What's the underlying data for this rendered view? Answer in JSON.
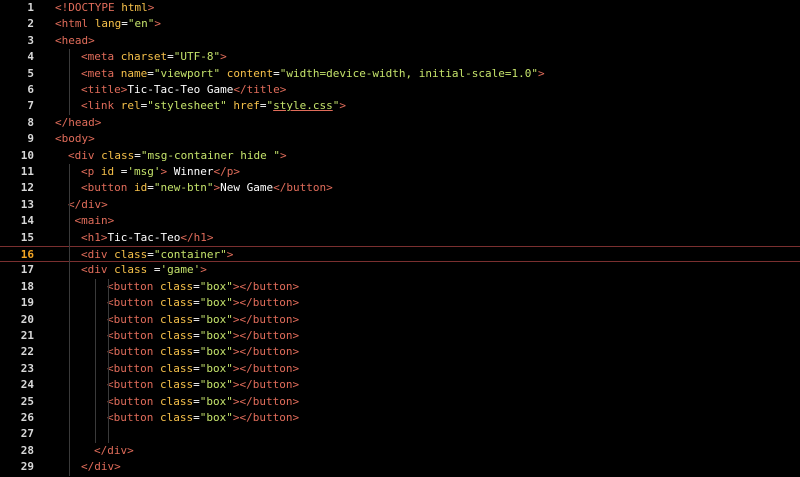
{
  "editor": {
    "current_line": 16,
    "lines": [
      {
        "n": "1",
        "indent": 0,
        "tokens": [
          [
            "punct",
            "<!"
          ],
          [
            "tag",
            "DOCTYPE"
          ],
          [
            "txt",
            " "
          ],
          [
            "attr",
            "html"
          ],
          [
            "punct",
            ">"
          ]
        ]
      },
      {
        "n": "2",
        "indent": 0,
        "tokens": [
          [
            "punct",
            "<"
          ],
          [
            "tag",
            "html"
          ],
          [
            "txt",
            " "
          ],
          [
            "attr",
            "lang"
          ],
          [
            "txt",
            "="
          ],
          [
            "str",
            "\"en\""
          ],
          [
            "punct",
            ">"
          ]
        ]
      },
      {
        "n": "3",
        "indent": 0,
        "tokens": [
          [
            "punct",
            "<"
          ],
          [
            "tag",
            "head"
          ],
          [
            "punct",
            ">"
          ]
        ]
      },
      {
        "n": "4",
        "indent": 1,
        "tokens": [
          [
            "punct",
            "<"
          ],
          [
            "tag",
            "meta"
          ],
          [
            "txt",
            " "
          ],
          [
            "attr",
            "charset"
          ],
          [
            "txt",
            "="
          ],
          [
            "str",
            "\"UTF-8\""
          ],
          [
            "punct",
            ">"
          ]
        ]
      },
      {
        "n": "5",
        "indent": 1,
        "tokens": [
          [
            "punct",
            "<"
          ],
          [
            "tag",
            "meta"
          ],
          [
            "txt",
            " "
          ],
          [
            "attr",
            "name"
          ],
          [
            "txt",
            "="
          ],
          [
            "str",
            "\"viewport\""
          ],
          [
            "txt",
            " "
          ],
          [
            "attr",
            "content"
          ],
          [
            "txt",
            "="
          ],
          [
            "str",
            "\"width=device-width, initial-scale=1.0\""
          ],
          [
            "punct",
            ">"
          ]
        ]
      },
      {
        "n": "6",
        "indent": 1,
        "tokens": [
          [
            "punct",
            "<"
          ],
          [
            "tag",
            "title"
          ],
          [
            "punct",
            ">"
          ],
          [
            "txt",
            "Tic-Tac-Teo Game"
          ],
          [
            "punct",
            "</"
          ],
          [
            "tag",
            "title"
          ],
          [
            "punct",
            ">"
          ]
        ]
      },
      {
        "n": "7",
        "indent": 1,
        "tokens": [
          [
            "punct",
            "<"
          ],
          [
            "tag",
            "link"
          ],
          [
            "txt",
            " "
          ],
          [
            "attr",
            "rel"
          ],
          [
            "txt",
            "="
          ],
          [
            "str",
            "\"stylesheet\""
          ],
          [
            "txt",
            " "
          ],
          [
            "attr",
            "href"
          ],
          [
            "txt",
            "="
          ],
          [
            "str",
            "\""
          ],
          [
            "link",
            "style.css"
          ],
          [
            "str",
            "\""
          ],
          [
            "punct",
            ">"
          ]
        ]
      },
      {
        "n": "8",
        "indent": 0,
        "tokens": [
          [
            "punct",
            "</"
          ],
          [
            "tag",
            "head"
          ],
          [
            "punct",
            ">"
          ]
        ]
      },
      {
        "n": "9",
        "indent": 0,
        "tokens": [
          [
            "punct",
            "<"
          ],
          [
            "tag",
            "body"
          ],
          [
            "punct",
            ">"
          ]
        ]
      },
      {
        "n": "10",
        "indent": 0.5,
        "tokens": [
          [
            "punct",
            "<"
          ],
          [
            "tag",
            "div"
          ],
          [
            "txt",
            " "
          ],
          [
            "attr",
            "class"
          ],
          [
            "txt",
            "="
          ],
          [
            "str",
            "\"msg-container hide \""
          ],
          [
            "punct",
            ">"
          ]
        ]
      },
      {
        "n": "11",
        "indent": 1,
        "tokens": [
          [
            "punct",
            "<"
          ],
          [
            "tag",
            "p"
          ],
          [
            "txt",
            " "
          ],
          [
            "attr",
            "id"
          ],
          [
            "txt",
            " ="
          ],
          [
            "str",
            "'msg'"
          ],
          [
            "punct",
            ">"
          ],
          [
            "txt",
            " Winner"
          ],
          [
            "punct",
            "</"
          ],
          [
            "tag",
            "p"
          ],
          [
            "punct",
            ">"
          ]
        ]
      },
      {
        "n": "12",
        "indent": 1,
        "tokens": [
          [
            "punct",
            "<"
          ],
          [
            "tag",
            "button"
          ],
          [
            "txt",
            " "
          ],
          [
            "attr",
            "id"
          ],
          [
            "txt",
            "="
          ],
          [
            "str",
            "\"new-btn\""
          ],
          [
            "punct",
            ">"
          ],
          [
            "txt",
            "New Game"
          ],
          [
            "punct",
            "</"
          ],
          [
            "tag",
            "button"
          ],
          [
            "punct",
            ">"
          ]
        ]
      },
      {
        "n": "13",
        "indent": 0.5,
        "tokens": [
          [
            "punct",
            "</"
          ],
          [
            "tag",
            "div"
          ],
          [
            "punct",
            ">"
          ]
        ]
      },
      {
        "n": "14",
        "indent": 0.75,
        "tokens": [
          [
            "punct",
            "<"
          ],
          [
            "tag",
            "main"
          ],
          [
            "punct",
            ">"
          ]
        ]
      },
      {
        "n": "15",
        "indent": 1,
        "tokens": [
          [
            "punct",
            "<"
          ],
          [
            "tag",
            "h1"
          ],
          [
            "punct",
            ">"
          ],
          [
            "txt",
            "Tic-Tac-Teo"
          ],
          [
            "punct",
            "</"
          ],
          [
            "tag",
            "h1"
          ],
          [
            "punct",
            ">"
          ]
        ]
      },
      {
        "n": "16",
        "indent": 1,
        "tokens": [
          [
            "punct",
            "<"
          ],
          [
            "tag",
            "div"
          ],
          [
            "txt",
            " "
          ],
          [
            "attr",
            "class"
          ],
          [
            "txt",
            "="
          ],
          [
            "str",
            "\"container\""
          ],
          [
            "punct",
            ">"
          ]
        ]
      },
      {
        "n": "17",
        "indent": 1,
        "tokens": [
          [
            "punct",
            "<"
          ],
          [
            "tag",
            "div"
          ],
          [
            "txt",
            " "
          ],
          [
            "attr",
            "class"
          ],
          [
            "txt",
            " ="
          ],
          [
            "str",
            "'game'"
          ],
          [
            "punct",
            ">"
          ]
        ]
      },
      {
        "n": "18",
        "indent": 2,
        "tokens": [
          [
            "punct",
            "<"
          ],
          [
            "tag",
            "button"
          ],
          [
            "txt",
            " "
          ],
          [
            "attr",
            "class"
          ],
          [
            "txt",
            "="
          ],
          [
            "str",
            "\"box\""
          ],
          [
            "punct",
            "></"
          ],
          [
            "tag",
            "button"
          ],
          [
            "punct",
            ">"
          ]
        ]
      },
      {
        "n": "19",
        "indent": 2,
        "tokens": [
          [
            "punct",
            "<"
          ],
          [
            "tag",
            "button"
          ],
          [
            "txt",
            " "
          ],
          [
            "attr",
            "class"
          ],
          [
            "txt",
            "="
          ],
          [
            "str",
            "\"box\""
          ],
          [
            "punct",
            "></"
          ],
          [
            "tag",
            "button"
          ],
          [
            "punct",
            ">"
          ]
        ]
      },
      {
        "n": "20",
        "indent": 2,
        "tokens": [
          [
            "punct",
            "<"
          ],
          [
            "tag",
            "button"
          ],
          [
            "txt",
            " "
          ],
          [
            "attr",
            "class"
          ],
          [
            "txt",
            "="
          ],
          [
            "str",
            "\"box\""
          ],
          [
            "punct",
            "></"
          ],
          [
            "tag",
            "button"
          ],
          [
            "punct",
            ">"
          ]
        ]
      },
      {
        "n": "21",
        "indent": 2,
        "tokens": [
          [
            "punct",
            "<"
          ],
          [
            "tag",
            "button"
          ],
          [
            "txt",
            " "
          ],
          [
            "attr",
            "class"
          ],
          [
            "txt",
            "="
          ],
          [
            "str",
            "\"box\""
          ],
          [
            "punct",
            "></"
          ],
          [
            "tag",
            "button"
          ],
          [
            "punct",
            ">"
          ]
        ]
      },
      {
        "n": "22",
        "indent": 2,
        "tokens": [
          [
            "punct",
            "<"
          ],
          [
            "tag",
            "button"
          ],
          [
            "txt",
            " "
          ],
          [
            "attr",
            "class"
          ],
          [
            "txt",
            "="
          ],
          [
            "str",
            "\"box\""
          ],
          [
            "punct",
            "></"
          ],
          [
            "tag",
            "button"
          ],
          [
            "punct",
            ">"
          ]
        ]
      },
      {
        "n": "23",
        "indent": 2,
        "tokens": [
          [
            "punct",
            "<"
          ],
          [
            "tag",
            "button"
          ],
          [
            "txt",
            " "
          ],
          [
            "attr",
            "class"
          ],
          [
            "txt",
            "="
          ],
          [
            "str",
            "\"box\""
          ],
          [
            "punct",
            "></"
          ],
          [
            "tag",
            "button"
          ],
          [
            "punct",
            ">"
          ]
        ]
      },
      {
        "n": "24",
        "indent": 2,
        "tokens": [
          [
            "punct",
            "<"
          ],
          [
            "tag",
            "button"
          ],
          [
            "txt",
            " "
          ],
          [
            "attr",
            "class"
          ],
          [
            "txt",
            "="
          ],
          [
            "str",
            "\"box\""
          ],
          [
            "punct",
            "></"
          ],
          [
            "tag",
            "button"
          ],
          [
            "punct",
            ">"
          ]
        ]
      },
      {
        "n": "25",
        "indent": 2,
        "tokens": [
          [
            "punct",
            "<"
          ],
          [
            "tag",
            "button"
          ],
          [
            "txt",
            " "
          ],
          [
            "attr",
            "class"
          ],
          [
            "txt",
            "="
          ],
          [
            "str",
            "\"box\""
          ],
          [
            "punct",
            "></"
          ],
          [
            "tag",
            "button"
          ],
          [
            "punct",
            ">"
          ]
        ]
      },
      {
        "n": "26",
        "indent": 2,
        "tokens": [
          [
            "punct",
            "<"
          ],
          [
            "tag",
            "button"
          ],
          [
            "txt",
            " "
          ],
          [
            "attr",
            "class"
          ],
          [
            "txt",
            "="
          ],
          [
            "str",
            "\"box\""
          ],
          [
            "punct",
            "></"
          ],
          [
            "tag",
            "button"
          ],
          [
            "punct",
            ">"
          ]
        ]
      },
      {
        "n": "27",
        "indent": 0,
        "tokens": []
      },
      {
        "n": "28",
        "indent": 1.5,
        "tokens": [
          [
            "punct",
            "</"
          ],
          [
            "tag",
            "div"
          ],
          [
            "punct",
            ">"
          ]
        ]
      },
      {
        "n": "29",
        "indent": 1,
        "tokens": [
          [
            "punct",
            "</"
          ],
          [
            "tag",
            "div"
          ],
          [
            "punct",
            ">"
          ]
        ]
      }
    ]
  },
  "colors": {
    "background": "#000000",
    "tag": "#e06c5a",
    "attribute": "#f5c04a",
    "string": "#c5e36b",
    "text": "#ffffff",
    "line_number": "#d8d8d8",
    "current_line_number": "#f5a623",
    "current_line_border": "#7a2f2f"
  }
}
